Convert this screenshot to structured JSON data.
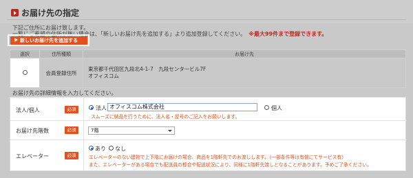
{
  "page": {
    "title": "お届け先の指定",
    "intro_line1": "下記ご住所にお届け致します。",
    "intro_line2": "一覧にご希望の住所が無い場合は、「新しいお届け先を追加する」より追加登録してください。",
    "intro_warn": "※最大99件まで登録できます。",
    "add_button_label": "新しいお届け先を追加する"
  },
  "address_table": {
    "headers": [
      "選択",
      "住所種類",
      "お届け先"
    ],
    "rows": [
      {
        "type": "会員登録住所",
        "address_line1": "東京都千代田区九段北4-1-7　九段センタービル7F",
        "address_line2": "オフィスコム",
        "selected": false
      }
    ]
  },
  "details": {
    "section_label": "お届け先の詳細情報を入力してください。",
    "required_badge": "必須",
    "entity_row": {
      "label": "法人/個人",
      "option_corporate": "法人",
      "company_name_value": "オフィスコム株式会社",
      "option_individual": "個人",
      "selected": "corporate",
      "note": "スムーズに納品を行うために、法人名・屋号のご記入をお願いします。"
    },
    "floors_row": {
      "label": "お届け先階数",
      "selected_value": "7階"
    },
    "elevator_row": {
      "label": "エレベーター",
      "option_yes": "あり",
      "option_no": "なし",
      "selected": "yes",
      "note1": "エレベーターのない建物で上下階にお届けの場合、商品を1階軒先でのお渡しします。（一部条件等は有償にてサービス有）",
      "note2": "また、エレベーターがある場合でも配送員の都合や配送状況により、同様に1階軒先渡しとなることがあります。予めご了承ください。"
    }
  }
}
